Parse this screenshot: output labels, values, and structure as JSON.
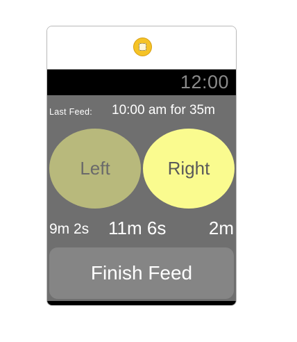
{
  "scene": {
    "icon": "storyboard-scene-icon"
  },
  "status": {
    "time": "12:00"
  },
  "last_feed": {
    "label": "Last Feed:",
    "value": "10:00 am for 35m"
  },
  "buttons": {
    "left_label": "Left",
    "right_label": "Right",
    "finish_label": "Finish Feed"
  },
  "timers": {
    "left": "9m 2s",
    "total": "11m 6s",
    "right": "2m"
  },
  "colors": {
    "left_button": "#b8b97c",
    "right_button": "#fafb8f",
    "screen_background": "#6f6f6f",
    "finish_button": "#858585",
    "scene_icon": "#f5c326"
  }
}
